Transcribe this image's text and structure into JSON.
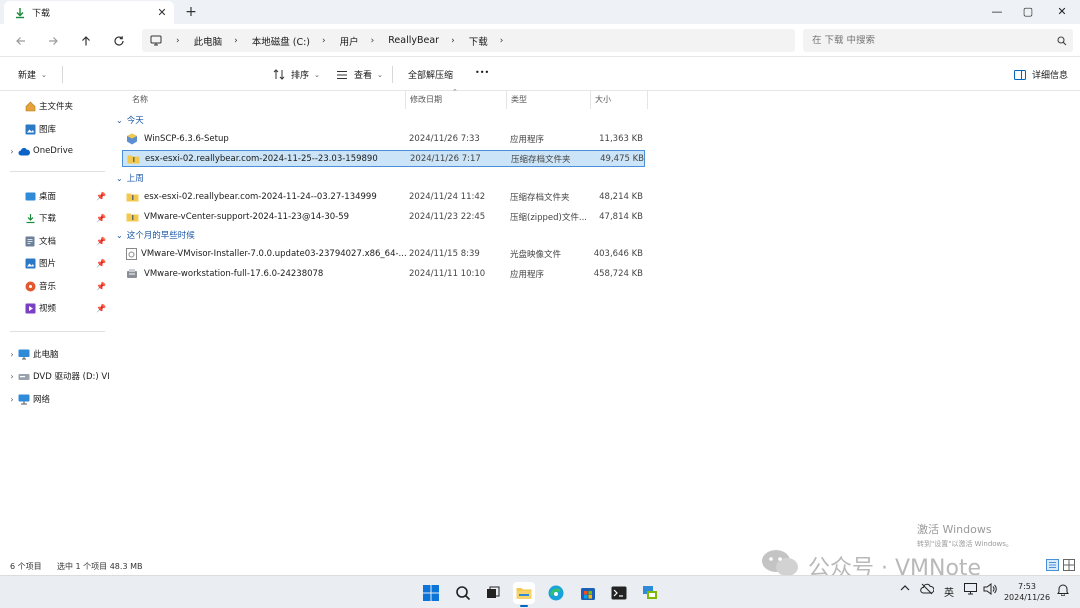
{
  "tab": {
    "title": "下载",
    "close": "✕",
    "new_tab": "+"
  },
  "window_controls": {
    "minimize": "—",
    "maximize": "▢",
    "close": "✕"
  },
  "breadcrumb": [
    "此电脑",
    "本地磁盘 (C:)",
    "用户",
    "ReallyBear",
    "下载"
  ],
  "search": {
    "placeholder": "在 下载 中搜索"
  },
  "commands": {
    "new": "新建",
    "sort": "排序",
    "view": "查看",
    "extract_all": "全部解压缩",
    "more": "•••",
    "details": "详细信息"
  },
  "sidebar": {
    "home": "主文件夹",
    "gallery": "图库",
    "onedrive": "OneDrive",
    "pinned": [
      "桌面",
      "下载",
      "文档",
      "图片",
      "音乐",
      "视频"
    ],
    "this_pc": "此电脑",
    "dvd": "DVD 驱动器 (D:) VI",
    "network": "网络"
  },
  "columns": {
    "name": "名称",
    "date": "修改日期",
    "type": "类型",
    "size": "大小"
  },
  "groups": {
    "today": {
      "label": "今天",
      "files": [
        {
          "name": "WinSCP-6.3.6-Setup",
          "date": "2024/11/26 7:33",
          "type": "应用程序",
          "size": "11,363 KB"
        },
        {
          "name": "esx-esxi-02.reallybear.com-2024-11-25--23.03-159890",
          "date": "2024/11/26 7:17",
          "type": "压缩存档文件夹",
          "size": "49,475 KB"
        }
      ]
    },
    "last_week": {
      "label": "上周",
      "files": [
        {
          "name": "esx-esxi-02.reallybear.com-2024-11-24--03.27-134999",
          "date": "2024/11/24 11:42",
          "type": "压缩存档文件夹",
          "size": "48,214 KB"
        },
        {
          "name": "VMware-vCenter-support-2024-11-23@14-30-59",
          "date": "2024/11/23 22:45",
          "type": "压缩(zipped)文件...",
          "size": "47,814 KB"
        }
      ]
    },
    "earlier": {
      "label": "这个月的早些时候",
      "files": [
        {
          "name": "VMware-VMvisor-Installer-7.0.0.update03-23794027.x86_64-...",
          "date": "2024/11/15 8:39",
          "type": "光盘映像文件",
          "size": "403,646 KB"
        },
        {
          "name": "VMware-workstation-full-17.6.0-24238078",
          "date": "2024/11/11 10:10",
          "type": "应用程序",
          "size": "458,724 KB"
        }
      ]
    }
  },
  "status": {
    "count": "6 个项目",
    "selected": "选中 1 个项目  48.3 MB"
  },
  "watermark": {
    "activate_title": "激活 Windows",
    "activate_sub": "转到\"设置\"以激活 Windows。",
    "wechat": "公众号 · VMNote"
  },
  "tray": {
    "lang": "英",
    "time": "7:53",
    "date": "2024/11/26"
  },
  "colors": {
    "accent": "#0067c0",
    "selection": "#cce4f7",
    "folder": "#f2c94c"
  }
}
